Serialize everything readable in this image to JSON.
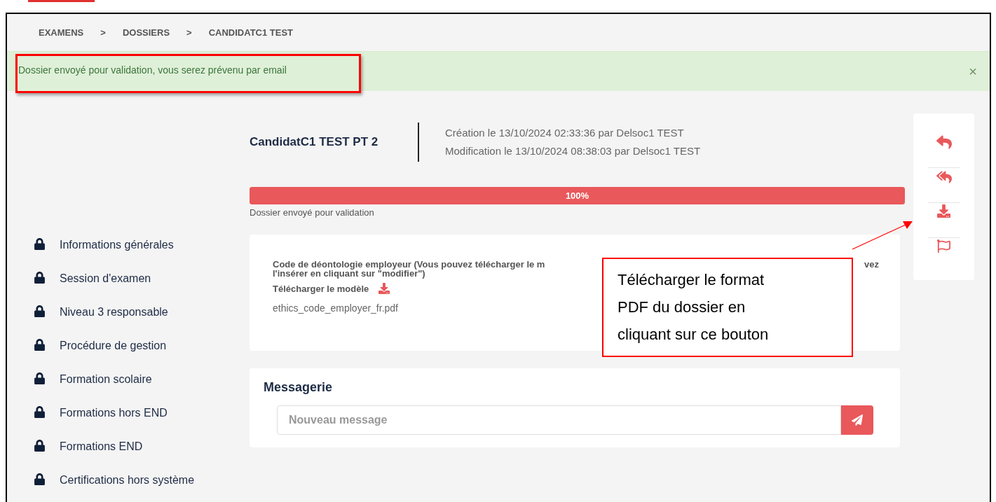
{
  "breadcrumb": {
    "items": [
      "EXAMENS",
      "DOSSIERS",
      "CANDIDATC1 TEST"
    ],
    "separator": ">"
  },
  "alert": {
    "message": "Dossier envoyé pour validation, vous serez prévenu par email",
    "close": "×"
  },
  "sidebar": {
    "items": [
      {
        "label": "Informations générales",
        "locked": true
      },
      {
        "label": "Session d'examen",
        "locked": true
      },
      {
        "label": "Niveau 3 responsable",
        "locked": true
      },
      {
        "label": "Procédure de gestion",
        "locked": true
      },
      {
        "label": "Formation scolaire",
        "locked": true
      },
      {
        "label": "Formations hors END",
        "locked": true
      },
      {
        "label": "Formations END",
        "locked": true
      },
      {
        "label": "Certifications hors système",
        "locked": true
      }
    ]
  },
  "dossier": {
    "title": "CandidatC1 TEST PT 2",
    "created": "Création le 13/10/2024 02:33:36 par Delsoc1 TEST",
    "modified": "Modification le 13/10/2024 08:38:03 par Delsoc1 TEST",
    "progress": {
      "level": 1,
      "label": "100%",
      "status": "Dossier envoyé pour validation"
    }
  },
  "document_card": {
    "description_start": "Code de déontologie employeur (Vous pouvez télécharger le m",
    "description_end": "vez",
    "description_line_2": "l'insérer en cliquant sur \"modifier\")",
    "download_label": "Télécharger le modèle",
    "file_name": "ethics_code_employer_fr.pdf"
  },
  "messaging": {
    "title": "Messagerie",
    "placeholder": "Nouveau message"
  },
  "actions": [
    {
      "kind": "reply"
    },
    {
      "kind": "reply_all"
    },
    {
      "kind": "download"
    },
    {
      "kind": "flag"
    }
  ],
  "annotation": {
    "callout": "Télécharger le format PDF du dossier en cliquant sur ce bouton"
  }
}
